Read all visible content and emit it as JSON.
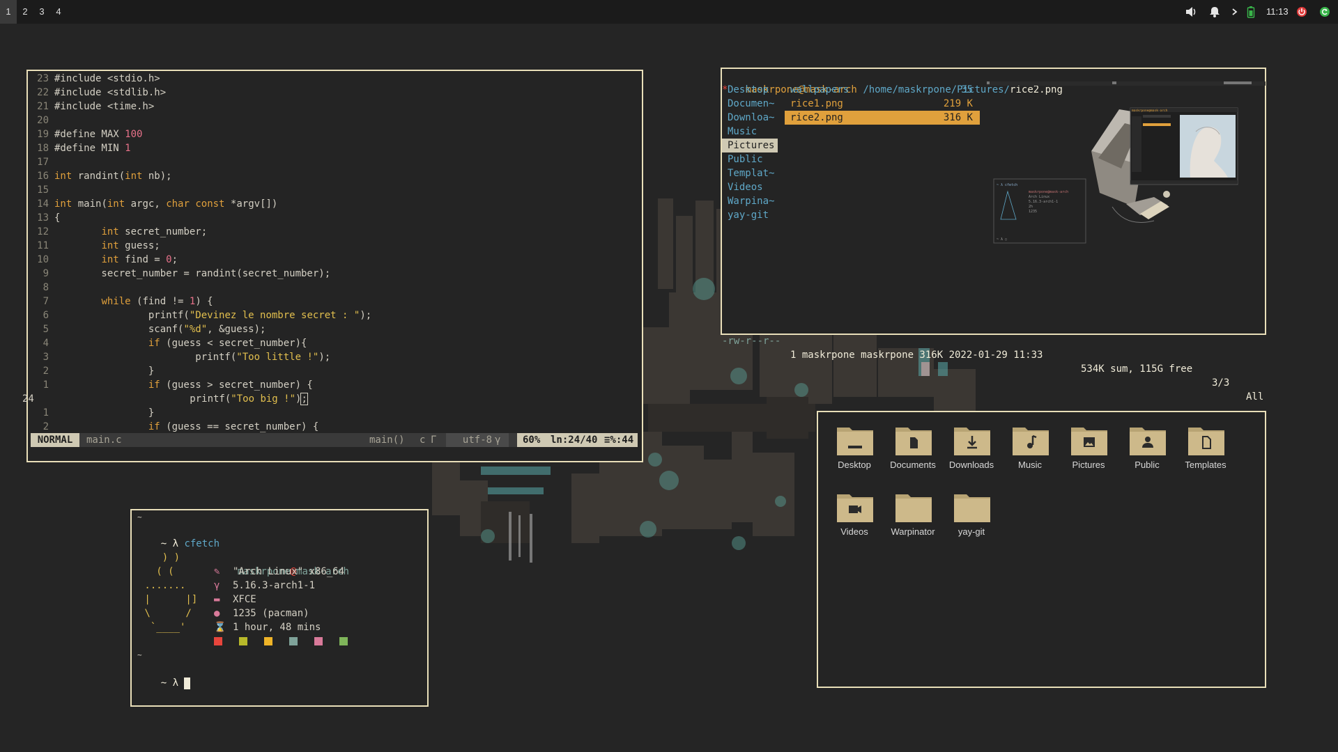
{
  "topbar": {
    "workspaces": [
      "1",
      "2",
      "3",
      "4"
    ],
    "active_workspace": "1",
    "clock": "11:13",
    "icons": [
      "volume-icon",
      "bell-icon",
      "chevron-right-icon",
      "battery-icon",
      "power-icon",
      "update-icon"
    ]
  },
  "editor": {
    "lines": [
      {
        "n": "23",
        "code": "#include <stdio.h>"
      },
      {
        "n": "22",
        "code": "#include <stdlib.h>"
      },
      {
        "n": "21",
        "code": "#include <time.h>"
      },
      {
        "n": "20",
        "code": ""
      },
      {
        "n": "19",
        "code": "#define MAX 100"
      },
      {
        "n": "18",
        "code": "#define MIN 1"
      },
      {
        "n": "17",
        "code": ""
      },
      {
        "n": "16",
        "code": "int randint(int nb);"
      },
      {
        "n": "15",
        "code": ""
      },
      {
        "n": "14",
        "code": "int main(int argc, char const *argv[])"
      },
      {
        "n": "13",
        "code": "{"
      },
      {
        "n": "12",
        "code": "        int secret_number;"
      },
      {
        "n": "11",
        "code": "        int guess;"
      },
      {
        "n": "10",
        "code": "        int find = 0;"
      },
      {
        "n": "9",
        "code": "        secret_number = randint(secret_number);"
      },
      {
        "n": "8",
        "code": ""
      },
      {
        "n": "7",
        "code": "        while (find != 1) {"
      },
      {
        "n": "6",
        "code": "                printf(\"Devinez le nombre secret : \");"
      },
      {
        "n": "5",
        "code": "                scanf(\"%d\", &guess);"
      },
      {
        "n": "4",
        "code": "                if (guess < secret_number){"
      },
      {
        "n": "3",
        "code": "                        printf(\"Too little !\");"
      },
      {
        "n": "2",
        "code": "                }"
      },
      {
        "n": "1",
        "code": "                if (guess > secret_number) {"
      },
      {
        "n": "24",
        "code": "                        printf(\"Too big !\");"
      },
      {
        "n": "1",
        "code": "                }"
      },
      {
        "n": "2",
        "code": "                if (guess == secret_number) {"
      }
    ],
    "status": {
      "mode": "NORMAL",
      "file": "main.c",
      "func": "main()",
      "filetype": "c",
      "encoding": "utf-8",
      "percent": "60%",
      "position": "ln:24/40",
      "column": "≡%:44"
    }
  },
  "ranger": {
    "header_user": "maskrpone@mask-arch",
    "header_path": "/home/maskrpone/Pictures/",
    "header_file": "rice2.png",
    "left_items": [
      "Desktop",
      "Documen~",
      "Downloa~",
      "Music",
      "Pictures",
      "Public",
      "Templat~",
      "Videos",
      "Warpina~",
      "yay-git"
    ],
    "selected_left": "Pictures",
    "middle_items": [
      {
        "name": "wallpapers",
        "size": "35"
      },
      {
        "name": "rice1.png",
        "size": "219 K"
      },
      {
        "name": "rice2.png",
        "size": "316 K"
      }
    ],
    "footer": {
      "perms": "-rw-r--r--",
      "info": "1 maskrpone maskrpone 316K 2022-01-29 11:33",
      "sum": "534K sum, 115G free",
      "count": "3/3",
      "scroll": "All"
    },
    "preview_fetch": {
      "user": "maskrpone@mask-arch",
      "os": "Arch Linux",
      "kernel": "5.16.3-arch1-1",
      "uptime": "2h",
      "pkgs": "1235"
    }
  },
  "thunar": {
    "folders": [
      {
        "label": "Desktop",
        "icon": "desktop-folder-icon"
      },
      {
        "label": "Documents",
        "icon": "documents-folder-icon"
      },
      {
        "label": "Downloads",
        "icon": "downloads-folder-icon"
      },
      {
        "label": "Music",
        "icon": "music-folder-icon"
      },
      {
        "label": "Pictures",
        "icon": "pictures-folder-icon"
      },
      {
        "label": "Public",
        "icon": "public-folder-icon"
      },
      {
        "label": "Templates",
        "icon": "templates-folder-icon"
      },
      {
        "label": "Videos",
        "icon": "videos-folder-icon"
      },
      {
        "label": "Warpinator",
        "icon": "folder-icon"
      },
      {
        "label": "yay-git",
        "icon": "folder-icon"
      }
    ]
  },
  "terminal": {
    "tilde1": "~",
    "prompt1": "~ λ",
    "command": "cfetch",
    "ascii": [
      "    ) )",
      "   ( (",
      " .......",
      " |      |]",
      " \\      /",
      "  `____'"
    ],
    "user": "maskrpone",
    "at": "@",
    "host": "mask-arch",
    "info": [
      "\"Arch Linux\" x86_64",
      "5.16.3-arch1-1",
      "XFCE",
      "1235 (pacman)",
      "1 hour, 48 mins"
    ],
    "palette": [
      "#e8453c",
      "#b8b92a",
      "#efb428",
      "#7fa39a",
      "#d97a9a",
      "#7fb55a"
    ],
    "tilde2": "~",
    "prompt2": "~ λ"
  },
  "colors": {
    "border": "#e9dfb9",
    "accent": "#e0a03c",
    "folder": "#cdb98a"
  }
}
